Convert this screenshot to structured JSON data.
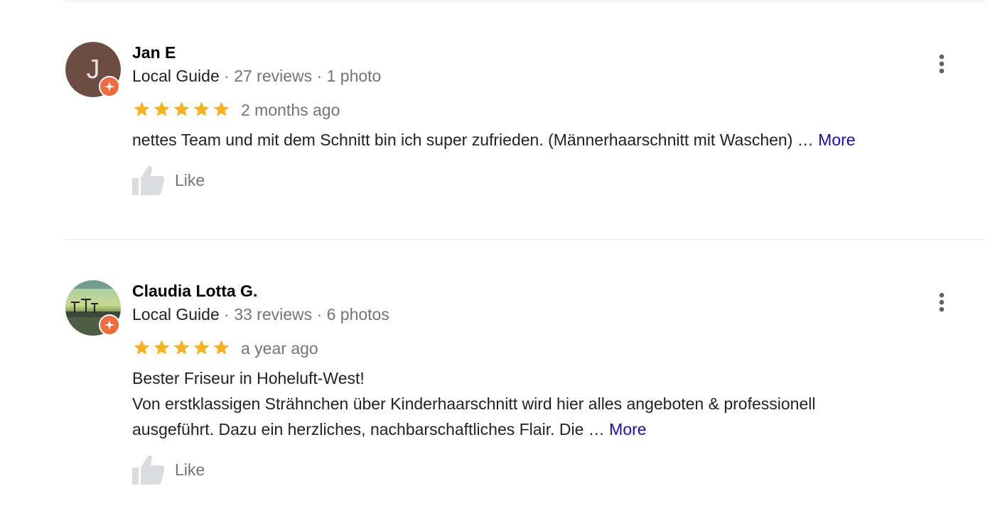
{
  "reviews": [
    {
      "name": "Jan E",
      "avatar_letter": "J",
      "role": "Local Guide",
      "reviews_count": "27 reviews",
      "photos_count": "1 photo",
      "separator": "·",
      "rating": 5,
      "time": "2 months ago",
      "text_lines": [
        "nettes Team und mit dem Schnitt bin ich super zufrieden. (Männerhaarschnitt mit Waschen) …"
      ],
      "more_label": "More",
      "like_label": "Like"
    },
    {
      "name": "Claudia Lotta G.",
      "role": "Local Guide",
      "reviews_count": "33 reviews",
      "photos_count": "6 photos",
      "separator": "·",
      "rating": 5,
      "time": "a year ago",
      "text_lines": [
        "Bester Friseur in Hoheluft-West!",
        "Von erstklassigen Strähnchen über Kinderhaarschnitt wird hier alles angeboten & professionell",
        "ausgeführt. Dazu ein herzliches, nachbarschaftliches Flair. Die …"
      ],
      "more_label": "More",
      "like_label": "Like"
    }
  ],
  "colors": {
    "star": "#f5b223",
    "link": "#1a0dab",
    "badge": "#ef6c3c",
    "muted": "#70757a",
    "avatar_bg": "#6d4c41"
  },
  "icons": {
    "menu": "more-vert-icon",
    "like": "thumbs-up-icon",
    "badge": "local-guide-badge-icon",
    "star": "star-icon"
  }
}
